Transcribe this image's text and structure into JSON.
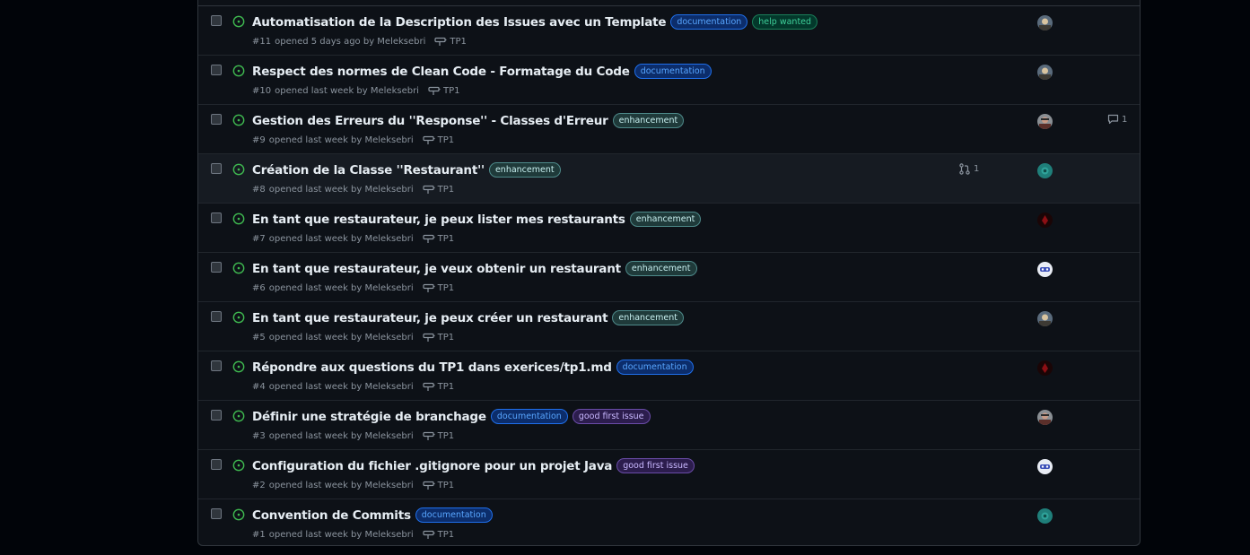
{
  "colors": {
    "page_bg": "#010409",
    "list_bg": "#0d1117",
    "open_icon": "#3fb950",
    "muted_text": "#8b949e"
  },
  "issues": [
    {
      "title": "Automatisation de la Description des Issues avec un Template",
      "number": "#11",
      "meta": "opened 5 days ago by Meleksebri",
      "milestone": "TP1",
      "labels": [
        {
          "text": "documentation",
          "kind": "documentation"
        },
        {
          "text": "help wanted",
          "kind": "help"
        }
      ],
      "avatar": "avatar-a"
    },
    {
      "title": "Respect des normes de Clean Code - Formatage du Code",
      "number": "#10",
      "meta": "opened last week by Meleksebri",
      "milestone": "TP1",
      "labels": [
        {
          "text": "documentation",
          "kind": "documentation"
        }
      ],
      "avatar": "avatar-a"
    },
    {
      "title": "Gestion des Erreurs du ''Response'' - Classes d'Erreur",
      "number": "#9",
      "meta": "opened last week by Meleksebri",
      "milestone": "TP1",
      "labels": [
        {
          "text": "enhancement",
          "kind": "enh"
        }
      ],
      "avatar": "avatar-b",
      "comments": "1"
    },
    {
      "title": "Création de la Classe ''Restaurant''",
      "number": "#8",
      "meta": "opened last week by Meleksebri",
      "milestone": "TP1",
      "labels": [
        {
          "text": "enhancement",
          "kind": "enh"
        }
      ],
      "avatar": "avatar-c",
      "linked_prs": "1"
    },
    {
      "title": "En tant que restaurateur, je peux lister mes restaurants",
      "number": "#7",
      "meta": "opened last week by Meleksebri",
      "milestone": "TP1",
      "labels": [
        {
          "text": "enhancement",
          "kind": "enh"
        }
      ],
      "avatar": "avatar-d"
    },
    {
      "title": "En tant que restaurateur, je veux obtenir un restaurant",
      "number": "#6",
      "meta": "opened last week by Meleksebri",
      "milestone": "TP1",
      "labels": [
        {
          "text": "enhancement",
          "kind": "enh"
        }
      ],
      "avatar": "avatar-e"
    },
    {
      "title": "En tant que restaurateur, je peux créer un restaurant",
      "number": "#5",
      "meta": "opened last week by Meleksebri",
      "milestone": "TP1",
      "labels": [
        {
          "text": "enhancement",
          "kind": "enh"
        }
      ],
      "avatar": "avatar-a"
    },
    {
      "title": "Répondre aux questions du TP1 dans exerices/tp1.md",
      "number": "#4",
      "meta": "opened last week by Meleksebri",
      "milestone": "TP1",
      "labels": [
        {
          "text": "documentation",
          "kind": "documentation"
        }
      ],
      "avatar": "avatar-d"
    },
    {
      "title": "Définir une stratégie de branchage",
      "number": "#3",
      "meta": "opened last week by Meleksebri",
      "milestone": "TP1",
      "labels": [
        {
          "text": "documentation",
          "kind": "documentation"
        },
        {
          "text": "good first issue",
          "kind": "gfi"
        }
      ],
      "avatar": "avatar-b"
    },
    {
      "title": "Configuration du fichier .gitignore pour un projet Java",
      "number": "#2",
      "meta": "opened last week by Meleksebri",
      "milestone": "TP1",
      "labels": [
        {
          "text": "good first issue",
          "kind": "gfi"
        }
      ],
      "avatar": "avatar-e"
    },
    {
      "title": "Convention de Commits",
      "number": "#1",
      "meta": "opened last week by Meleksebri",
      "milestone": "TP1",
      "labels": [
        {
          "text": "documentation",
          "kind": "documentation"
        }
      ],
      "avatar": "avatar-c"
    }
  ]
}
